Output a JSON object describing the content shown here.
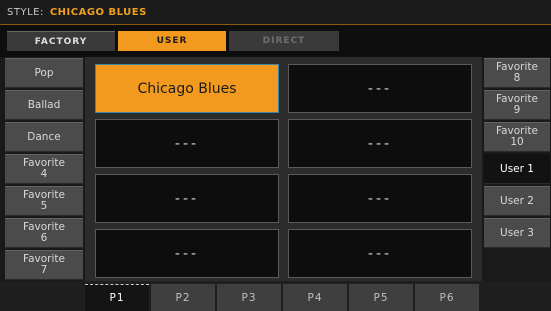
{
  "title_bar": {
    "label": "STYLE:",
    "value": "CHICAGO BLUES"
  },
  "top_tabs": [
    {
      "label": "FACTORY",
      "state": "normal"
    },
    {
      "label": "USER",
      "state": "selected"
    },
    {
      "label": "DIRECT",
      "state": "disabled"
    }
  ],
  "left_buttons": [
    "Pop",
    "Ballad",
    "Dance",
    "Favorite\n4",
    "Favorite\n5",
    "Favorite\n6",
    "Favorite\n7"
  ],
  "right_buttons": [
    "Favorite\n8",
    "Favorite\n9",
    "Favorite\n10",
    "User 1",
    "User 2",
    "User 3"
  ],
  "right_selected": "User 1",
  "grid_cells": [
    "Chicago Blues",
    "---",
    "---",
    "---",
    "---",
    "---",
    "---",
    "---"
  ],
  "selected_cell": "Chicago Blues",
  "page_tabs": [
    "P1",
    "P2",
    "P3",
    "P4",
    "P5",
    "P6"
  ],
  "selected_page": "P1",
  "colors": {
    "accent": "#f29a1f",
    "selection_outline": "#3d86a6"
  }
}
